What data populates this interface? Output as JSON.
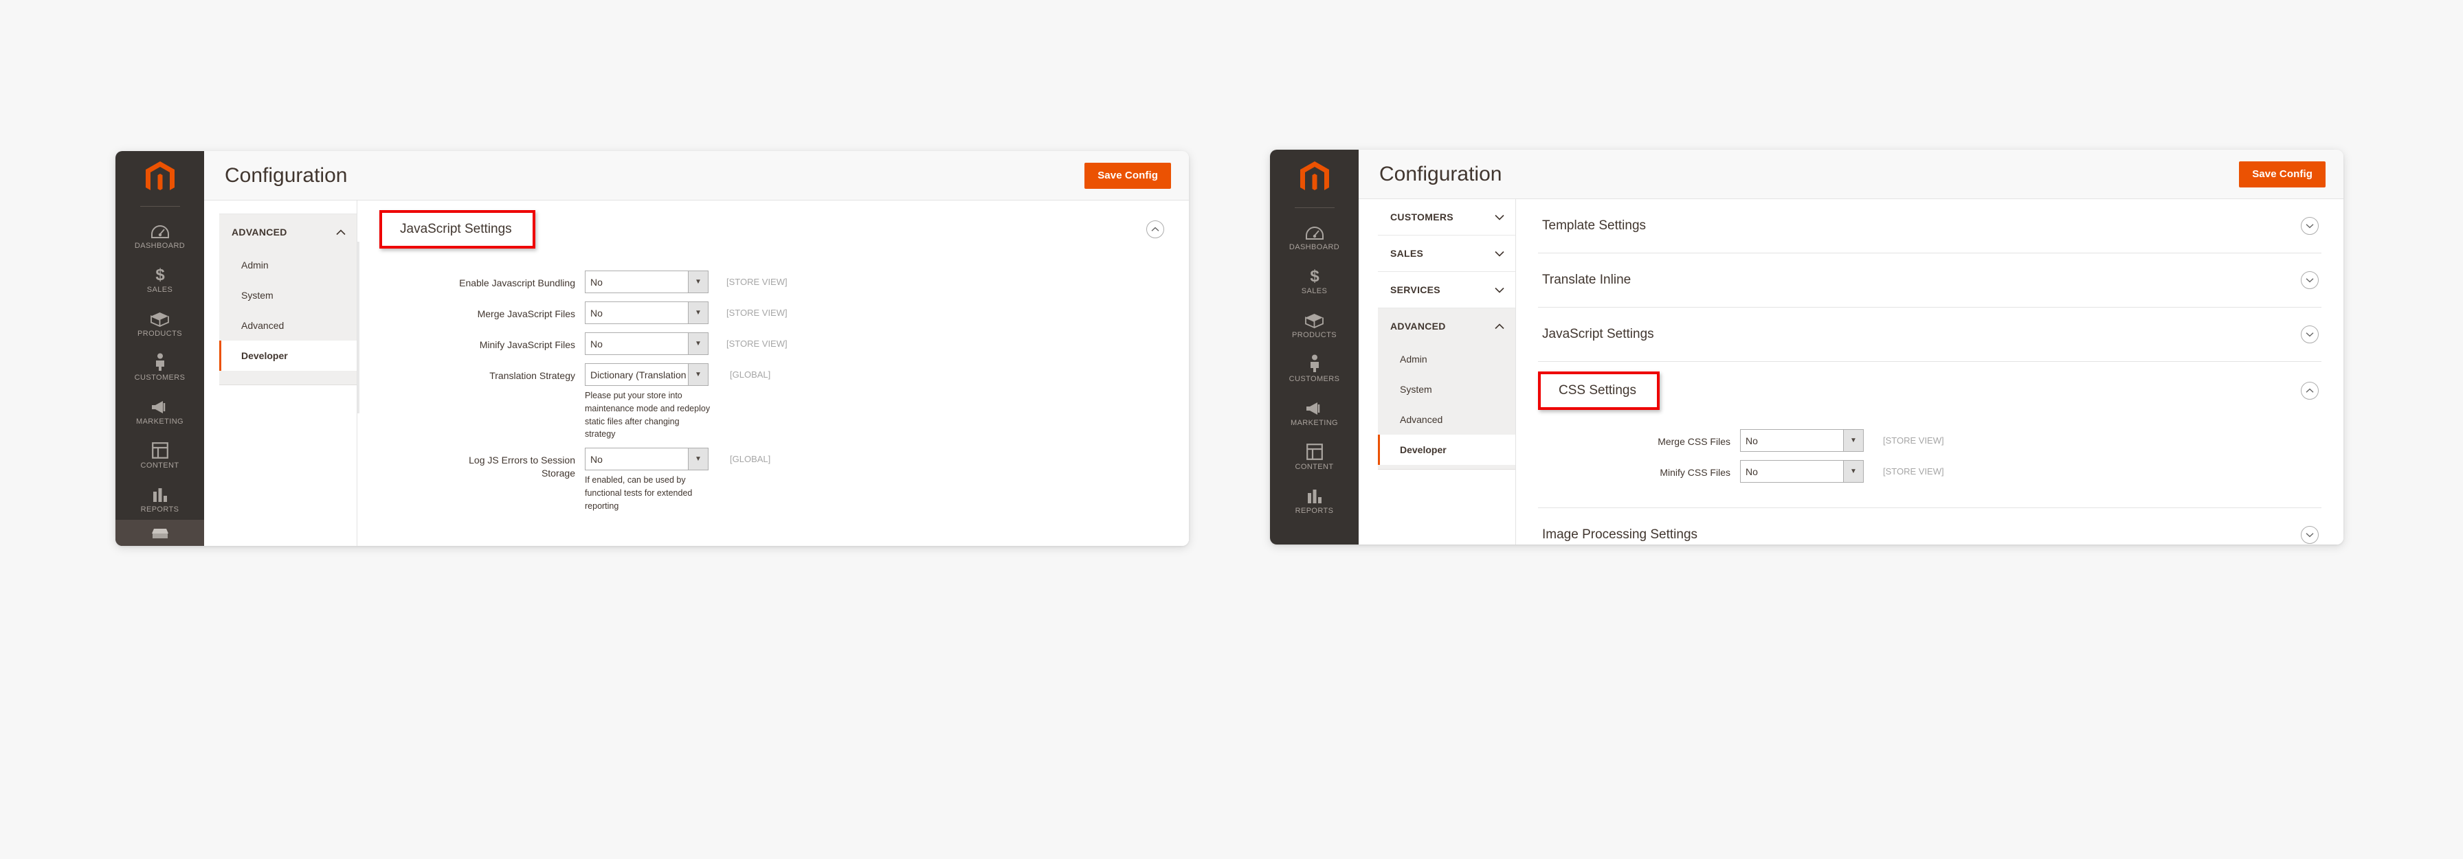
{
  "theme": {
    "brand_orange": "#eb5202",
    "sidebar_dark": "#373330",
    "highlight_red": "#ee0000",
    "text_dark": "#41362f",
    "scope_gray": "#a6a6a6"
  },
  "admin_rail": {
    "logo_name": "magento-logo-icon",
    "items": [
      {
        "label": "DASHBOARD",
        "icon": "dashboard-gauge-icon"
      },
      {
        "label": "SALES",
        "icon": "dollar-sign-icon"
      },
      {
        "label": "PRODUCTS",
        "icon": "box-icon"
      },
      {
        "label": "CUSTOMERS",
        "icon": "person-icon"
      },
      {
        "label": "MARKETING",
        "icon": "megaphone-icon"
      },
      {
        "label": "CONTENT",
        "icon": "layout-page-icon"
      },
      {
        "label": "REPORTS",
        "icon": "bar-chart-icon"
      },
      {
        "label": "",
        "icon": "stores-icon"
      }
    ]
  },
  "left_panel": {
    "header": {
      "title": "Configuration",
      "save_label": "Save Config"
    },
    "nav": {
      "groups": [
        {
          "label": "ADVANCED",
          "open": true,
          "chevron": "chevron-up-icon",
          "items": [
            {
              "label": "Admin",
              "active": false
            },
            {
              "label": "System",
              "active": false
            },
            {
              "label": "Advanced",
              "active": false
            },
            {
              "label": "Developer",
              "active": true
            }
          ]
        }
      ]
    },
    "section": {
      "title": "JavaScript Settings",
      "highlighted": true,
      "chevron": "chevron-up-circle-icon"
    },
    "fields": [
      {
        "label": "Enable Javascript Bundling",
        "value": "No",
        "scope": "[STORE VIEW]",
        "hint": ""
      },
      {
        "label": "Merge JavaScript Files",
        "value": "No",
        "scope": "[STORE VIEW]",
        "hint": ""
      },
      {
        "label": "Minify JavaScript Files",
        "value": "No",
        "scope": "[STORE VIEW]",
        "hint": ""
      },
      {
        "label": "Translation Strategy",
        "value": "Dictionary (Translation on Stor",
        "scope": "[GLOBAL]",
        "hint": "Please put your store into maintenance mode and redeploy static files after changing strategy"
      },
      {
        "label": "Log JS Errors to Session Storage",
        "value": "No",
        "scope": "[GLOBAL]",
        "hint": "If enabled, can be used by functional tests for extended reporting"
      }
    ]
  },
  "right_panel": {
    "header": {
      "title": "Configuration",
      "save_label": "Save Config"
    },
    "nav": {
      "groups": [
        {
          "label": "CUSTOMERS",
          "open": false,
          "chevron": "chevron-down-icon",
          "items": []
        },
        {
          "label": "SALES",
          "open": false,
          "chevron": "chevron-down-icon",
          "items": []
        },
        {
          "label": "SERVICES",
          "open": false,
          "chevron": "chevron-down-icon",
          "items": []
        },
        {
          "label": "ADVANCED",
          "open": true,
          "chevron": "chevron-up-icon",
          "items": [
            {
              "label": "Admin",
              "active": false
            },
            {
              "label": "System",
              "active": false
            },
            {
              "label": "Advanced",
              "active": false
            },
            {
              "label": "Developer",
              "active": true
            }
          ]
        }
      ]
    },
    "sections": [
      {
        "title": "Template Settings",
        "chevron": "chevron-down-circle-icon",
        "highlighted": false,
        "expanded": false
      },
      {
        "title": "Translate Inline",
        "chevron": "chevron-down-circle-icon",
        "highlighted": false,
        "expanded": false
      },
      {
        "title": "JavaScript Settings",
        "chevron": "chevron-down-circle-icon",
        "highlighted": false,
        "expanded": false
      },
      {
        "title": "CSS Settings",
        "chevron": "chevron-up-circle-icon",
        "highlighted": true,
        "expanded": true
      },
      {
        "title": "Image Processing Settings",
        "chevron": "chevron-down-circle-icon",
        "highlighted": false,
        "expanded": false
      }
    ],
    "css_fields": [
      {
        "label": "Merge CSS Files",
        "value": "No",
        "scope": "[STORE VIEW]"
      },
      {
        "label": "Minify CSS Files",
        "value": "No",
        "scope": "[STORE VIEW]"
      }
    ]
  }
}
